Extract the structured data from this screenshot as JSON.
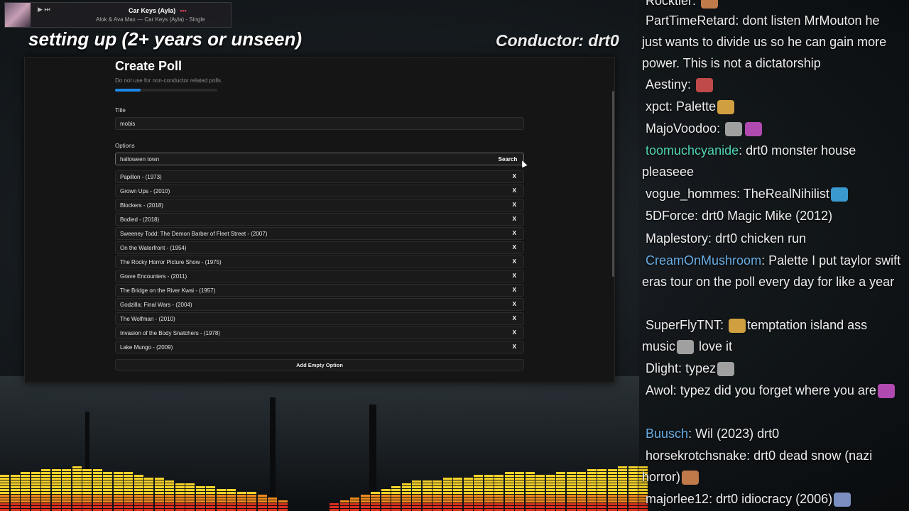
{
  "now_playing": {
    "title": "Car Keys (Ayla)",
    "subtitle": "Alok & Ava Max — Car Keys (Ayla) - Single",
    "controls": "▶ ⏭"
  },
  "overlay": {
    "left_heading": "setting up (2+ years or unseen)",
    "right_heading": "Conductor: drt0"
  },
  "poll": {
    "title": "Create Poll",
    "subtitle": "Do not use for non-conductor related polls.",
    "progress_fraction": 0.25,
    "title_label": "Title",
    "title_value": "mobis",
    "options_label": "Options",
    "search_value": "halloween town",
    "search_button": "Search",
    "remove_label": "X",
    "add_button": "Add Empty Option",
    "options": [
      "Papillon - (1973)",
      "Grown Ups - (2010)",
      "Blockers - (2018)",
      "Bodied - (2018)",
      "Sweeney Todd: The Demon Barber of Fleet Street - (2007)",
      "On the Waterfront - (1954)",
      "The Rocky Horror Picture Show - (1975)",
      "Grave Encounters - (2011)",
      "The Bridge on the River Kwai - (1957)",
      "Godzilla: Final Wars - (2004)",
      "The Wolfman - (2010)",
      "Invasion of the Body Snatchers - (1978)",
      "Lake Mungo - (2009)"
    ]
  },
  "chat": [
    {
      "user": "Rocktier",
      "text": ""
    },
    {
      "user": "PartTimeRetard",
      "text": "dont listen MrMouton he just wants to divide us so he can gain more power. This is not a dictatorship"
    },
    {
      "user": "Aestiny",
      "text": ""
    },
    {
      "user": "xpct",
      "text": "Palette"
    },
    {
      "user": "MajoVoodoo",
      "text": ""
    },
    {
      "user": "toomuchcyanide",
      "text": "drt0 monster house pleaseee",
      "color": "teal"
    },
    {
      "user": "vogue_hommes",
      "text": "TheRealNihilist"
    },
    {
      "user": "5DForce",
      "text": "drt0 Magic Mike (2012)"
    },
    {
      "user": "Maplestory",
      "text": "drt0 chicken run"
    },
    {
      "user": "CreamOnMushroom",
      "text": "Palette I put taylor swift eras tour on the poll every day for like a year",
      "color": "blue"
    },
    {
      "user": "SuperFlyTNT",
      "text": "temptation island ass music",
      "text2": "love it"
    },
    {
      "user": "Dlight",
      "text": "typez"
    },
    {
      "user": "Awol",
      "text": "typez did you forget where you are"
    },
    {
      "user": "Buusch",
      "text": "Wil (2023) drt0",
      "color": "blue"
    },
    {
      "user": "horsekrotchsnake",
      "text": "drt0 dead snow (nazi horror)"
    },
    {
      "user": "majorlee12",
      "text": "drt0 idiocracy (2006)"
    }
  ],
  "colors": {
    "accent": "#1e88e5",
    "chat_teal": "#4fd6b8",
    "chat_blue": "#6aaee6",
    "viz_yellow": "#f5d22a",
    "viz_orange": "#f08a1c",
    "viz_red": "#d8301e"
  }
}
